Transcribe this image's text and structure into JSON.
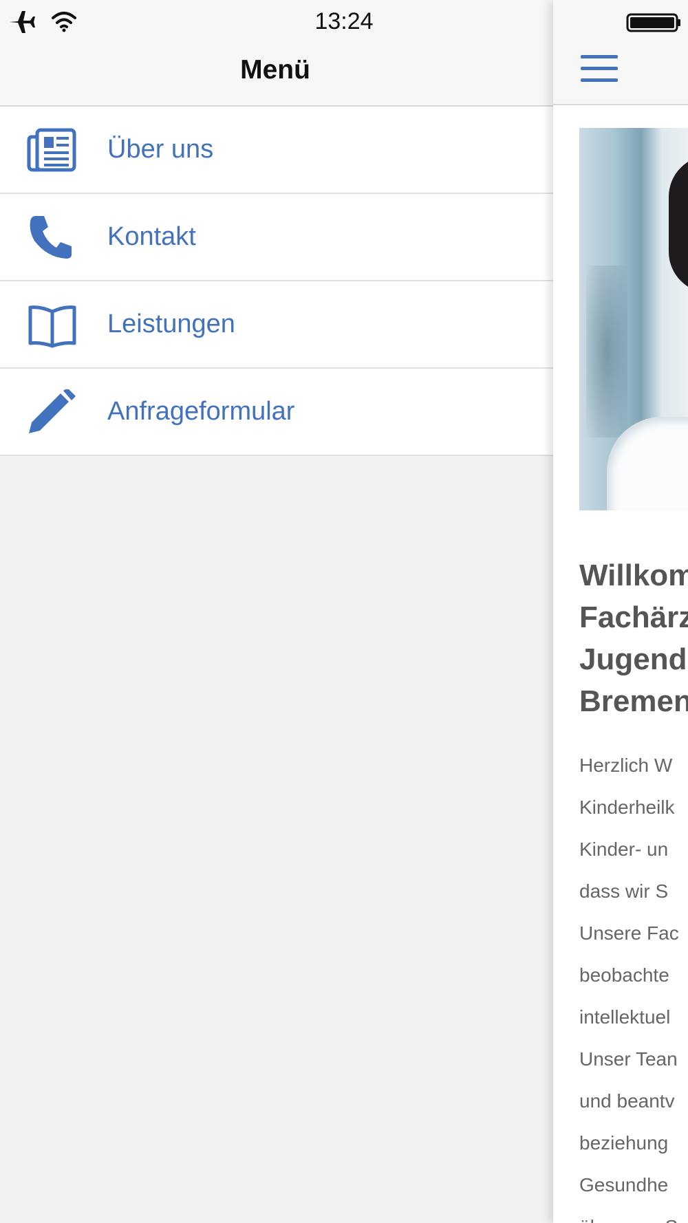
{
  "status_bar": {
    "time": "13:24",
    "icons": [
      "airplane-icon",
      "wifi-icon",
      "battery-icon"
    ]
  },
  "menu": {
    "title": "Menü",
    "items": [
      {
        "label": "Über uns",
        "icon": "newspaper-icon"
      },
      {
        "label": "Kontakt",
        "icon": "phone-icon"
      },
      {
        "label": "Leistungen",
        "icon": "book-icon"
      },
      {
        "label": "Anfrageformular",
        "icon": "pencil-icon"
      }
    ]
  },
  "content": {
    "nav_icon": "hamburger-icon",
    "headline": "Willkom\nFachärz\nJugend\nBremen",
    "body": "Herzlich W\nKinderheilk\nKinder- un\ndass wir S\nUnsere Fac\nbeobachte\nintellektuel\nUnser Tean\nund beantv\nbeziehung\nGesundhe\nüber vom S"
  },
  "colors": {
    "accent": "#4272bd",
    "header_bg": "#f7f7f7",
    "page_bg": "#f2f2f2"
  }
}
